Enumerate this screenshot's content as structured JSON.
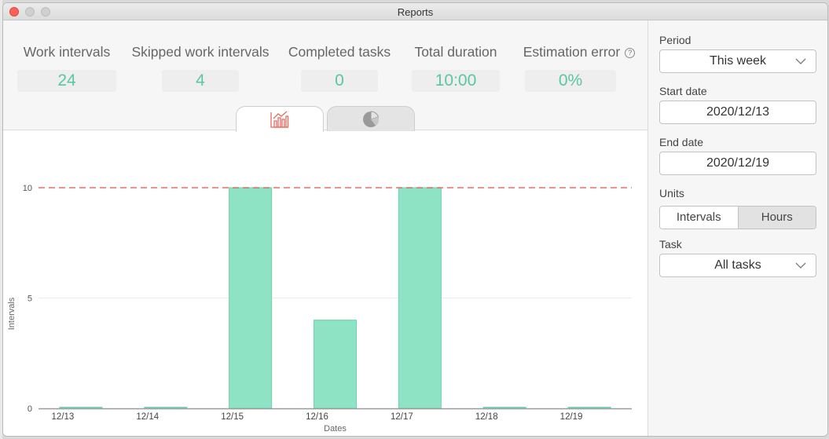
{
  "window": {
    "title": "Reports"
  },
  "stats": [
    {
      "label": "Work intervals",
      "value": "24"
    },
    {
      "label": "Skipped work intervals",
      "value": "4"
    },
    {
      "label": "Completed tasks",
      "value": "0"
    },
    {
      "label": "Total duration",
      "value": "10:00"
    },
    {
      "label": "Estimation error",
      "value": "0%"
    }
  ],
  "tabs": [
    {
      "icon": "bar-chart-icon",
      "active": true
    },
    {
      "icon": "pie-chart-icon",
      "active": false
    }
  ],
  "sidebar": {
    "period_label": "Period",
    "period_value": "This week",
    "start_label": "Start date",
    "start_value": "2020/12/13",
    "end_label": "End date",
    "end_value": "2020/12/19",
    "units_label": "Units",
    "units_options": [
      "Intervals",
      "Hours"
    ],
    "units_selected": "Intervals",
    "task_label": "Task",
    "task_value": "All tasks"
  },
  "colors": {
    "bar": "#8de3c3",
    "bar_stroke": "#6fd1ad",
    "target_line": "#d9534f",
    "value_text": "#5bc6a2",
    "active_tab_icon": "#e46b5f",
    "close": "#fe5f57"
  },
  "chart_data": {
    "type": "bar",
    "categories": [
      "12/13",
      "12/14",
      "12/15",
      "12/16",
      "12/17",
      "12/18",
      "12/19"
    ],
    "values": [
      0,
      0,
      10,
      4,
      10,
      0,
      0
    ],
    "xlabel": "Dates",
    "ylabel": "Intervals",
    "ylim": [
      0,
      10
    ],
    "yticks": [
      0,
      5,
      10
    ],
    "target_line": 10,
    "grid": true
  }
}
